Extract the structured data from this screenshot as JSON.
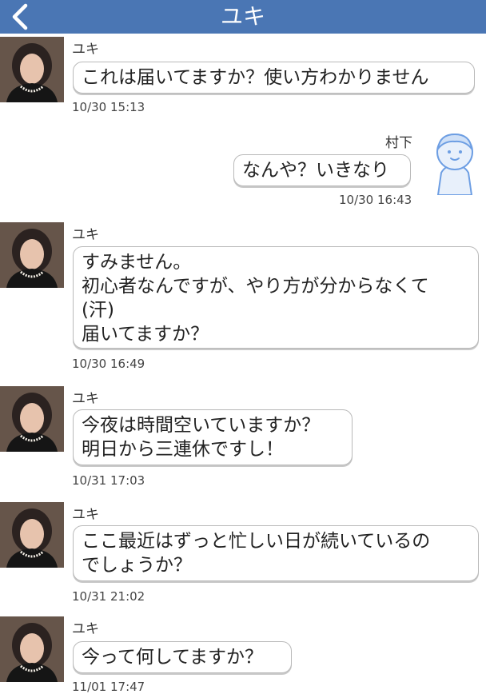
{
  "header": {
    "title": "ユキ",
    "back_icon": "chevron-left-icon"
  },
  "messages": [
    {
      "sender": "ユキ",
      "text": "これは届いてますか？使い方わかりません",
      "time": "10/30 15:13"
    },
    {
      "sender": "村下",
      "text": "なんや？いきなり",
      "time": "10/30 16:43"
    },
    {
      "sender": "ユキ",
      "text": "すみません。\n初心者なんですが、やり方が分からなくて\n(汗)\n届いてますか？",
      "time": "10/30 16:49"
    },
    {
      "sender": "ユキ",
      "text": "今夜は時間空いていますか？\n明日から三連休ですし！",
      "time": "10/31 17:03"
    },
    {
      "sender": "ユキ",
      "text": "ここ最近はずっと忙しい日が続いているの\nでしょうか？",
      "time": "10/31 21:02"
    },
    {
      "sender": "ユキ",
      "text": "今って何してますか？",
      "time": "11/01 17:47"
    }
  ],
  "colors": {
    "header": "#4a76b4",
    "bubble_border": "#b9b9b9"
  }
}
